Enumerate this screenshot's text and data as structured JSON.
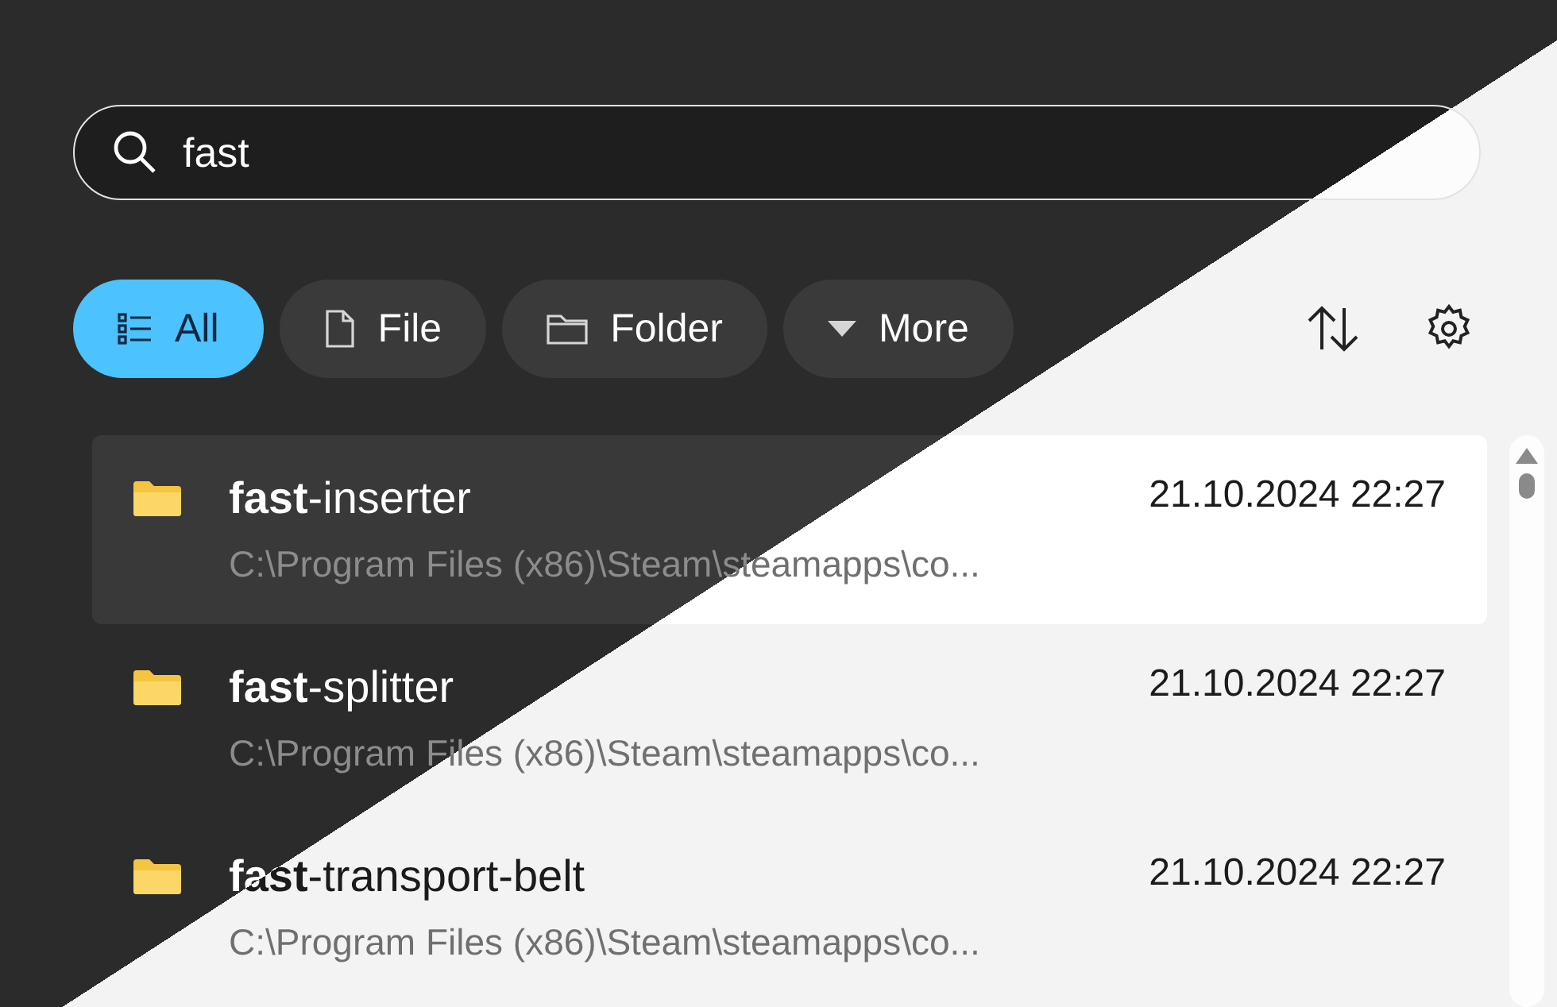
{
  "search": {
    "value": "fast"
  },
  "filters": [
    {
      "kind": "all",
      "label": "All",
      "selected": true
    },
    {
      "kind": "file",
      "label": "File",
      "selected": false
    },
    {
      "kind": "folder",
      "label": "Folder",
      "selected": false
    },
    {
      "kind": "menu",
      "label": "More",
      "selected": false
    }
  ],
  "results": [
    {
      "name": "**fast**-inserter",
      "date": "21.10.2024 22:27",
      "path": "C:\\Program Files (x86)\\Steam\\steamapps\\co...",
      "selected": true
    },
    {
      "name": "**fast**-splitter",
      "date": "21.10.2024 22:27",
      "path": "C:\\Program Files (x86)\\Steam\\steamapps\\co...",
      "selected": false
    },
    {
      "name": "**fast**-transport-belt",
      "date": "21.10.2024 22:27",
      "path": "C:\\Program Files (x86)\\Steam\\steamapps\\co...",
      "selected": false
    }
  ]
}
